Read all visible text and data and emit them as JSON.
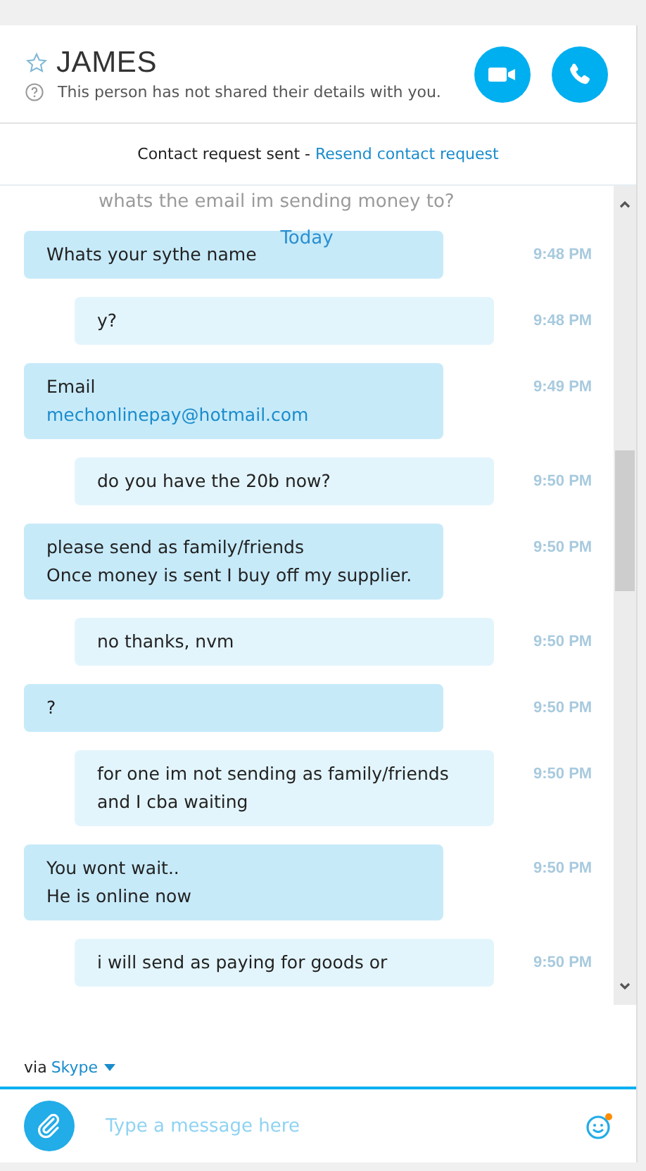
{
  "contact": {
    "name": "JAMES",
    "favorite": false,
    "subtitle": "This person has not shared their details with you."
  },
  "request_banner": {
    "text": "Contact request sent - ",
    "link": "Resend contact request"
  },
  "history": {
    "faded_text": "whats the email im sending money to?",
    "day_label": "Today"
  },
  "messages": [
    {
      "kind": "received",
      "time": "9:48 PM",
      "lines": [
        {
          "kind": "text",
          "text": "Whats your sythe name"
        }
      ]
    },
    {
      "kind": "sent",
      "time": "9:48 PM",
      "lines": [
        {
          "kind": "text",
          "text": "y?"
        }
      ]
    },
    {
      "kind": "received",
      "time": "9:49 PM",
      "lines": [
        {
          "kind": "text",
          "text": "Email"
        },
        {
          "kind": "link",
          "text": "mechonlinepay@hotmail.com"
        }
      ]
    },
    {
      "kind": "sent",
      "time": "9:50 PM",
      "lines": [
        {
          "kind": "text",
          "text": "do you have the 20b now?"
        }
      ]
    },
    {
      "kind": "received",
      "time": "9:50 PM",
      "lines": [
        {
          "kind": "text",
          "text": "please send as family/friends"
        },
        {
          "kind": "text",
          "text": "Once money is sent I buy off my supplier."
        }
      ]
    },
    {
      "kind": "sent",
      "time": "9:50 PM",
      "lines": [
        {
          "kind": "text",
          "text": "no thanks, nvm"
        }
      ]
    },
    {
      "kind": "received",
      "time": "9:50 PM",
      "lines": [
        {
          "kind": "text",
          "text": "?"
        }
      ]
    },
    {
      "kind": "sent",
      "time": "9:50 PM",
      "lines": [
        {
          "kind": "text",
          "text": "for one im not sending as family/friends"
        },
        {
          "kind": "text",
          "text": "and I cba waiting"
        }
      ]
    },
    {
      "kind": "received",
      "time": "9:50 PM",
      "lines": [
        {
          "kind": "text",
          "text": "You wont wait.."
        },
        {
          "kind": "text",
          "text": "He is online now"
        }
      ]
    },
    {
      "kind": "sent",
      "time": "9:50 PM",
      "lines": [
        {
          "kind": "text",
          "text": "i will send as paying for goods or"
        }
      ]
    }
  ],
  "composer": {
    "via_label": "via",
    "service": "Skype",
    "placeholder": "Type a message here",
    "emoji_notification": true
  }
}
